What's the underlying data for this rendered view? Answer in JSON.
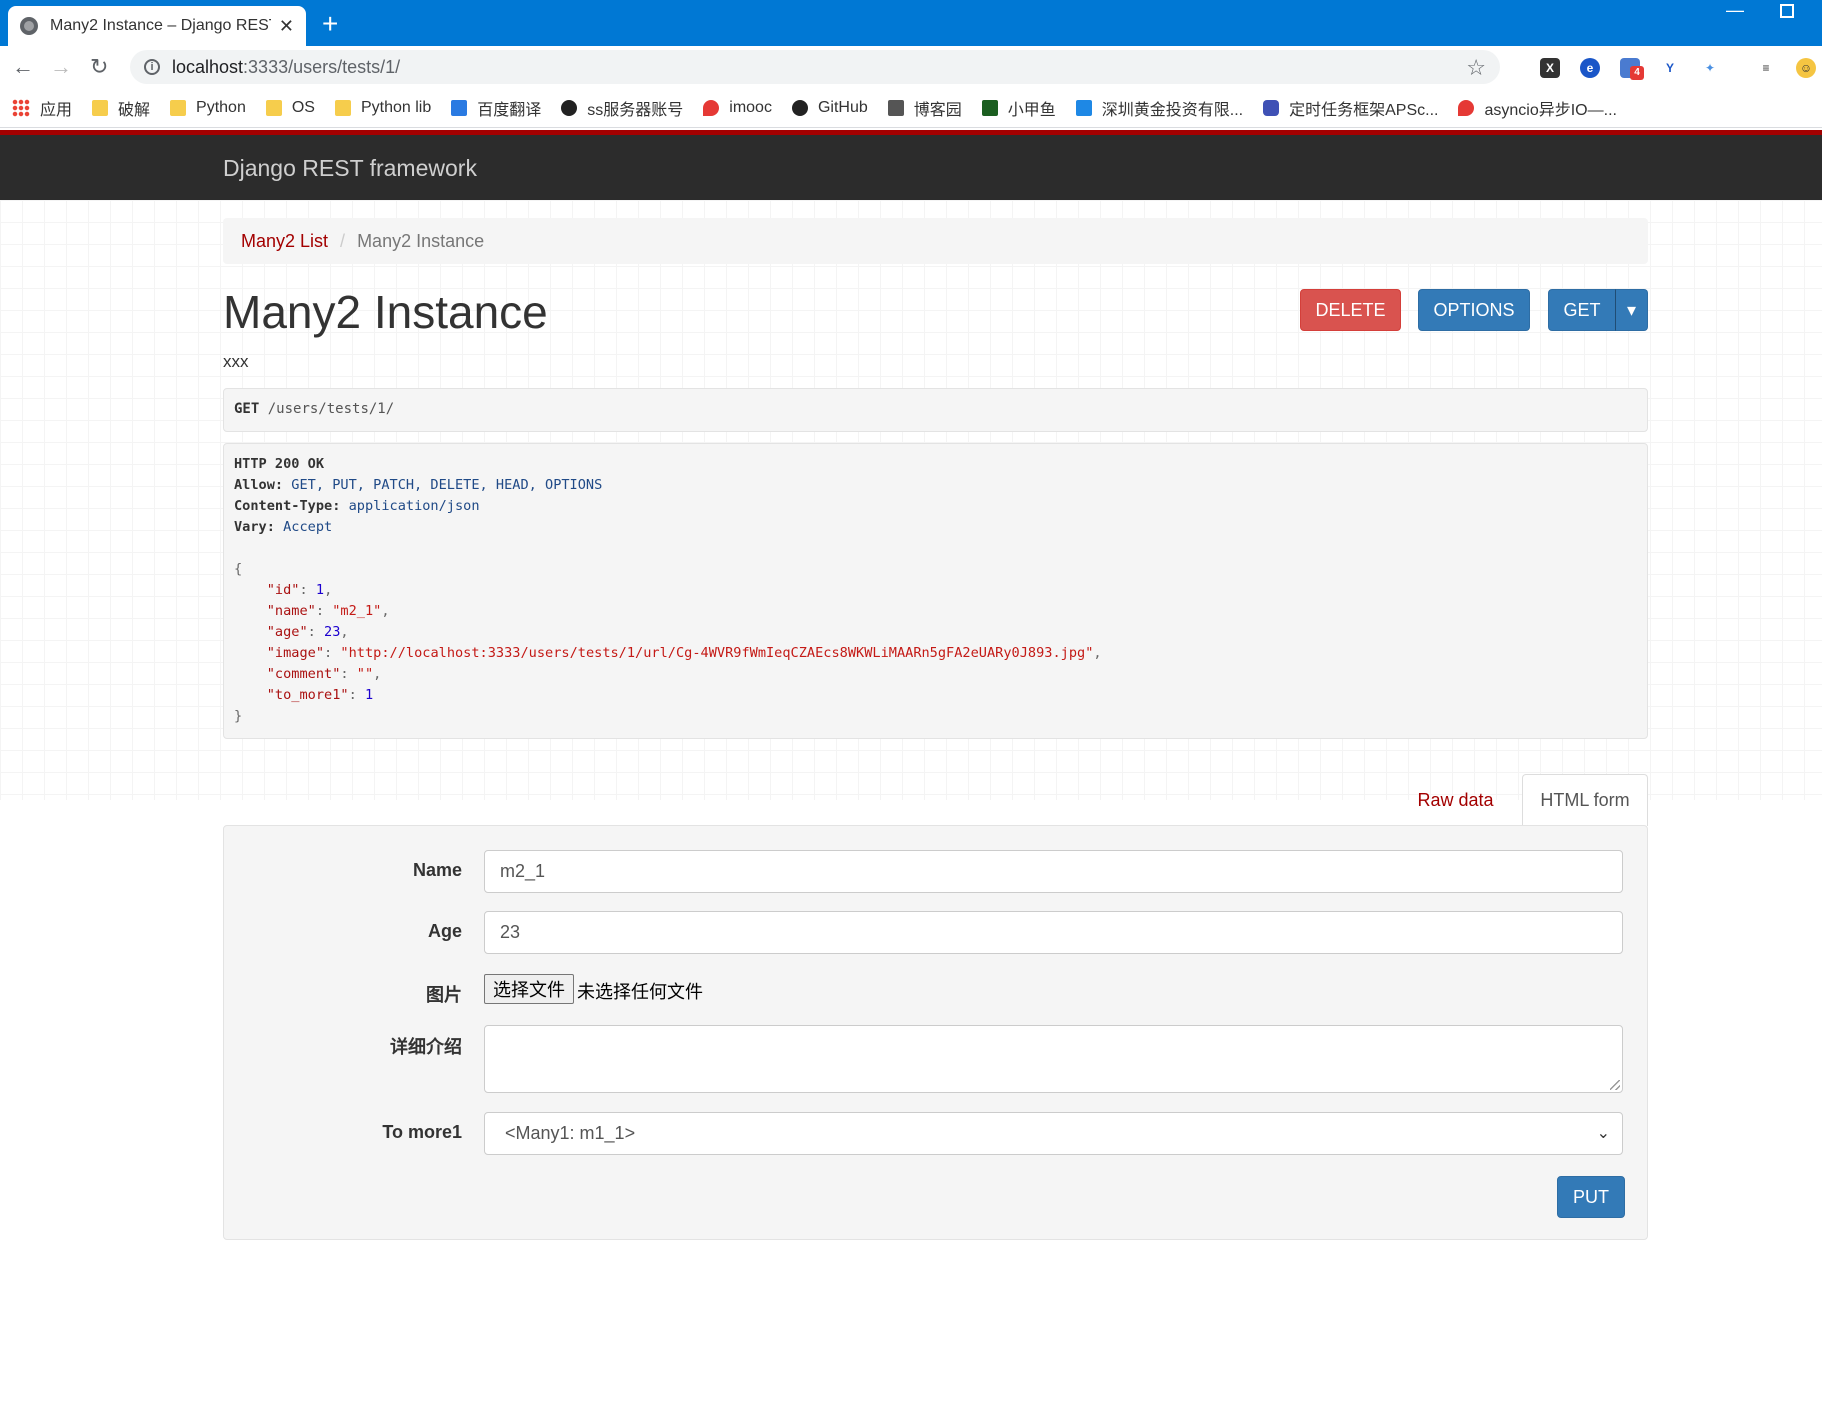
{
  "browser": {
    "tab_title": "Many2 Instance – Django REST",
    "tab_close": "✕",
    "new_tab": "+",
    "url_host": "localhost",
    "url_path": ":3333/users/tests/1/",
    "bookmarks": [
      {
        "label": "应用",
        "icon": "apps-grid-icon"
      },
      {
        "label": "破解",
        "icon": "folder-icon"
      },
      {
        "label": "Python",
        "icon": "folder-icon"
      },
      {
        "label": "OS",
        "icon": "folder-icon"
      },
      {
        "label": "Python lib",
        "icon": "folder-icon"
      },
      {
        "label": "百度翻译",
        "icon": "translate-icon"
      },
      {
        "label": "ss服务器账号",
        "icon": "github-icon"
      },
      {
        "label": "imooc",
        "icon": "flame-icon"
      },
      {
        "label": "GitHub",
        "icon": "github-icon"
      },
      {
        "label": "博客园",
        "icon": "blog-icon"
      },
      {
        "label": "小甲鱼",
        "icon": "fc-icon"
      },
      {
        "label": "深圳黄金投资有限...",
        "icon": "bowtie-icon"
      },
      {
        "label": "定时任务框架APSc...",
        "icon": "site-icon"
      },
      {
        "label": "asyncio异步IO—...",
        "icon": "flame-icon"
      }
    ],
    "ext_badge": "4"
  },
  "drf": {
    "brand": "Django REST framework",
    "breadcrumb": {
      "list_link": "Many2 List",
      "current": "Many2 Instance"
    },
    "title": "Many2 Instance",
    "description": "xxx",
    "buttons": {
      "delete": "DELETE",
      "options": "OPTIONS",
      "get": "GET",
      "get_caret": "▾"
    },
    "request": {
      "method": "GET",
      "path": "/users/tests/1/"
    },
    "response": {
      "status_line": "HTTP 200 OK",
      "headers": [
        {
          "key": "Allow:",
          "value": "GET, PUT, PATCH, DELETE, HEAD, OPTIONS"
        },
        {
          "key": "Content-Type:",
          "value": "application/json"
        },
        {
          "key": "Vary:",
          "value": "Accept"
        }
      ],
      "body": {
        "id": 1,
        "name": "m2_1",
        "age": 23,
        "image": "http://localhost:3333/users/tests/1/url/Cg-4WVR9fWmIeqCZAEcs8WKWLiMAARn5gFA2eUARy0J893.jpg",
        "comment": "",
        "to_more1": 1
      }
    },
    "tabs": {
      "raw": "Raw data",
      "html": "HTML form"
    },
    "form": {
      "name_label": "Name",
      "name_value": "m2_1",
      "age_label": "Age",
      "age_value": "23",
      "image_label": "图片",
      "file_button": "选择文件",
      "file_status": "未选择任何文件",
      "comment_label": "详细介绍",
      "to_more1_label": "To more1",
      "to_more1_value": "<Many1: m1_1>",
      "submit": "PUT"
    }
  }
}
